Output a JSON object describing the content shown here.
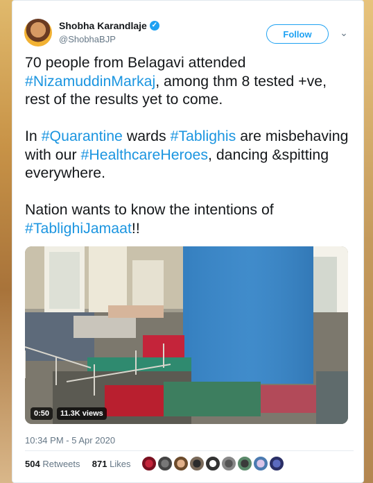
{
  "tweet": {
    "display_name": "Shobha Karandlaje",
    "verified_icon": "check-icon",
    "handle": "@ShobhaBJP",
    "follow_label": "Follow",
    "text_parts": [
      {
        "text": "70 people from Belagavi attended ",
        "tag": false
      },
      {
        "text": "#NizamuddinMarkaj",
        "tag": true
      },
      {
        "text": ", among thm 8 tested +ve, rest of the results yet to come.\n\nIn ",
        "tag": false
      },
      {
        "text": "#Quarantine",
        "tag": true
      },
      {
        "text": " wards ",
        "tag": false
      },
      {
        "text": "#Tablighis",
        "tag": true
      },
      {
        "text": " are misbehaving with our ",
        "tag": false
      },
      {
        "text": "#HealthcareHeroes",
        "tag": true
      },
      {
        "text": ", dancing &spitting everywhere.\n\nNation wants to know the intentions of ",
        "tag": false
      },
      {
        "text": "#TablighiJamaat",
        "tag": true
      },
      {
        "text": "!!",
        "tag": false
      }
    ],
    "video": {
      "duration": "0:50",
      "views": "11.3K views"
    },
    "timestamp": "10:34 PM - 5 Apr 2020",
    "retweets_count": "504",
    "retweets_label": "Retweets",
    "likes_count": "871",
    "likes_label": "Likes"
  },
  "colors": {
    "link": "#1b95e0",
    "twitter_blue": "#1da1f2",
    "text": "#14171a",
    "muted": "#657786"
  }
}
